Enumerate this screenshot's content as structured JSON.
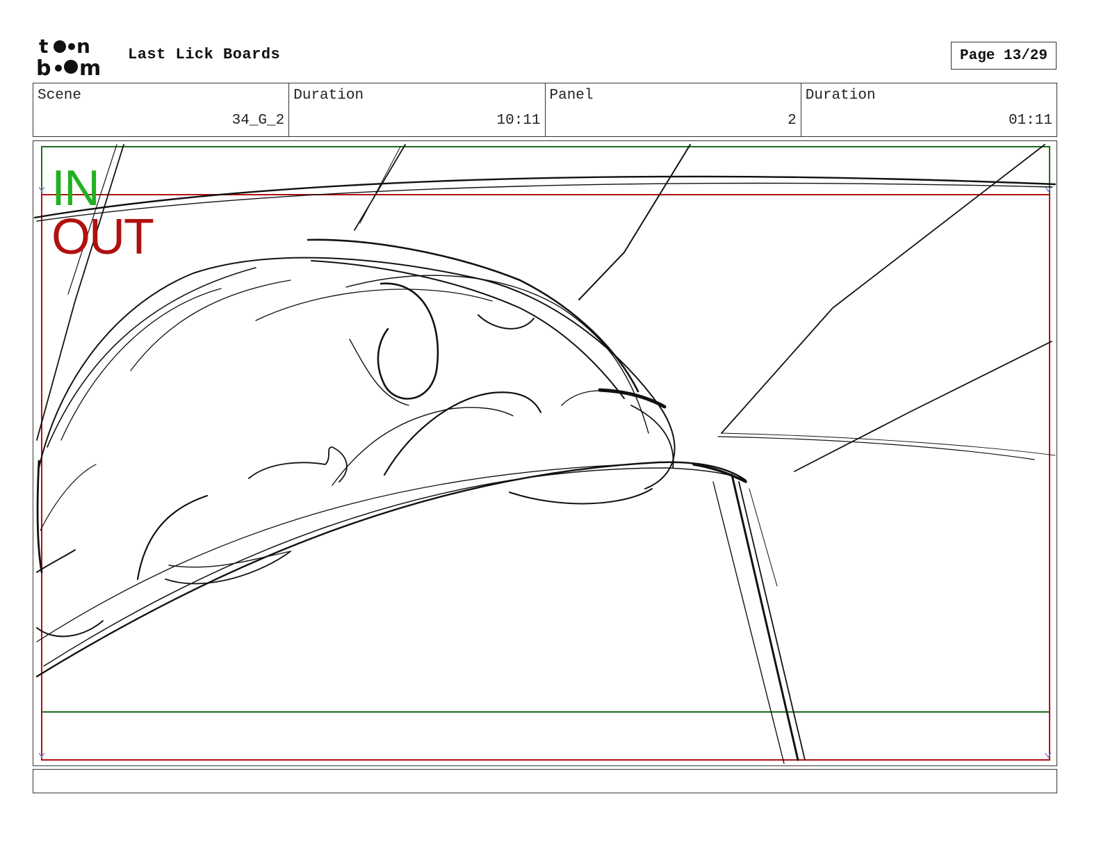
{
  "header": {
    "logo_text": "toon boom",
    "project_title": "Last Lick Boards",
    "page": "Page 13/29"
  },
  "info": {
    "scene_label": "Scene",
    "scene_value": "34_G_2",
    "scene_duration_label": "Duration",
    "scene_duration_value": "10:11",
    "panel_label": "Panel",
    "panel_value": "2",
    "panel_duration_label": "Duration",
    "panel_duration_value": "01:11"
  },
  "panel": {
    "in_label": "IN",
    "out_label": "OUT",
    "in_color": "#22b022",
    "out_color": "#b01010"
  },
  "notes": {
    "text": ""
  }
}
